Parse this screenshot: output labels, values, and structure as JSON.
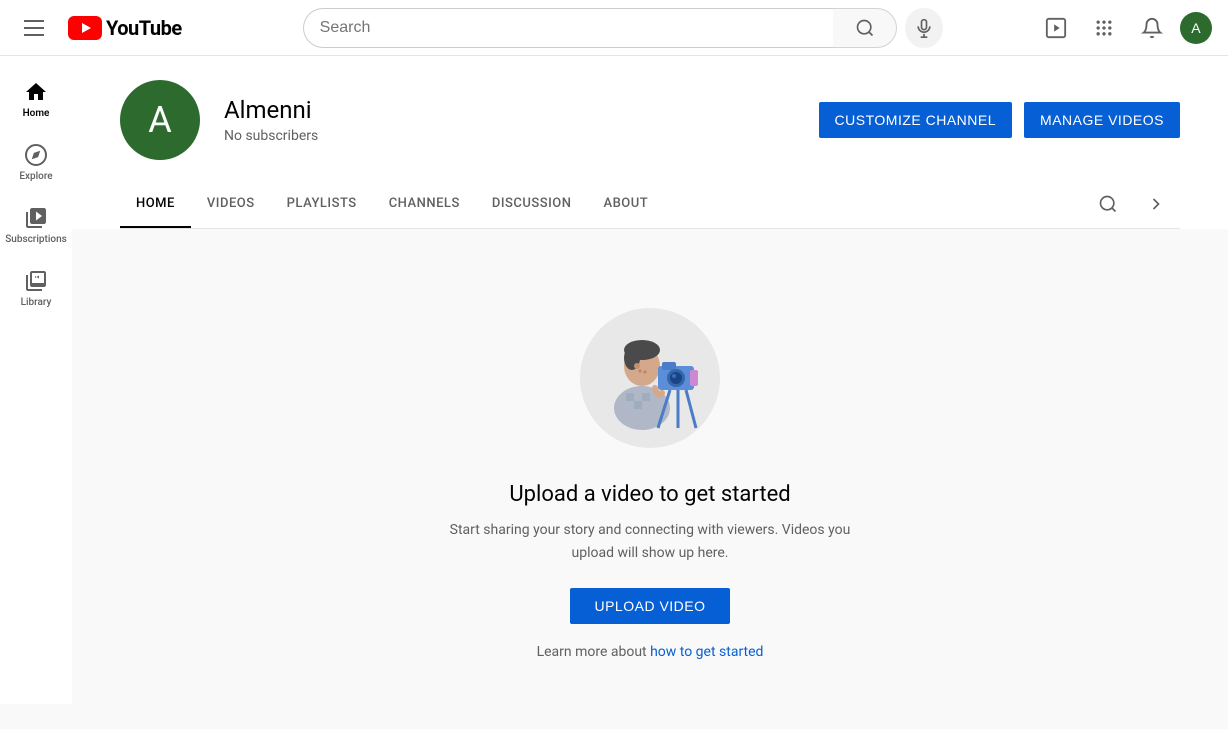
{
  "topnav": {
    "search_placeholder": "Search",
    "logo_text": "YouTube"
  },
  "sidebar": {
    "items": [
      {
        "id": "home",
        "label": "Home",
        "icon": "⌂",
        "active": true
      },
      {
        "id": "explore",
        "label": "Explore",
        "icon": "🔥"
      },
      {
        "id": "subscriptions",
        "label": "Subscriptions",
        "icon": "▤"
      },
      {
        "id": "library",
        "label": "Library",
        "icon": "◧"
      }
    ]
  },
  "channel": {
    "avatar_letter": "A",
    "name": "Almenni",
    "subscribers": "No subscribers",
    "customize_label": "CUSTOMIZE CHANNEL",
    "manage_label": "MANAGE VIDEOS"
  },
  "tabs": [
    {
      "id": "home",
      "label": "HOME",
      "active": true
    },
    {
      "id": "videos",
      "label": "VIDEOS",
      "active": false
    },
    {
      "id": "playlists",
      "label": "PLAYLISTS",
      "active": false
    },
    {
      "id": "channels",
      "label": "CHANNELS",
      "active": false
    },
    {
      "id": "discussion",
      "label": "DISCUSSION",
      "active": false
    },
    {
      "id": "about",
      "label": "ABOUT",
      "active": false
    }
  ],
  "empty_state": {
    "title": "Upload a video to get started",
    "description": "Start sharing your story and connecting with viewers. Videos you upload will show up here.",
    "upload_label": "UPLOAD VIDEO",
    "learn_more_prefix": "Learn more about ",
    "learn_more_link": "how to get started"
  }
}
